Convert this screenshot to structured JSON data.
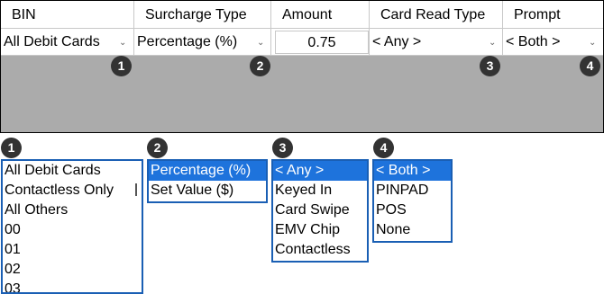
{
  "headers": [
    "BIN",
    "Surcharge Type",
    "Amount",
    "Card Read Type",
    "Prompt"
  ],
  "row": {
    "bin": "All Debit Cards",
    "surcharge_type": "Percentage (%)",
    "amount": "0.75",
    "card_read_type": "< Any >",
    "prompt": "< Both >"
  },
  "badges": [
    "1",
    "2",
    "3",
    "4"
  ],
  "lists": {
    "bin": [
      "All Debit Cards",
      "Contactless Only",
      "All Others",
      "00",
      "01",
      "02",
      "03"
    ],
    "surcharge_type": [
      "Percentage (%)",
      "Set Value ($)"
    ],
    "card_read_type": [
      "< Any >",
      "Keyed In",
      "Card Swipe",
      "EMV Chip",
      "Contactless"
    ],
    "prompt": [
      "< Both >",
      "PINPAD",
      "POS",
      "None"
    ]
  },
  "colors": {
    "selection": "#1e73dc",
    "list_border": "#1a5fb4",
    "grid_bg": "#ababab",
    "badge": "#333333"
  }
}
